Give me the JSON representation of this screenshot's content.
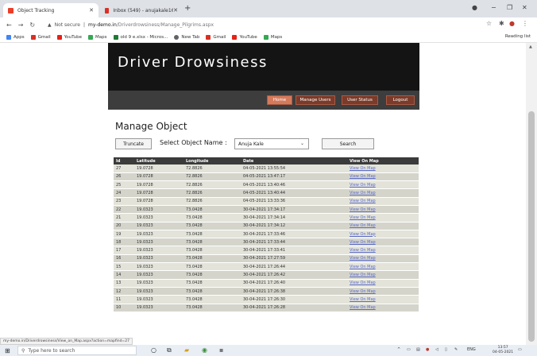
{
  "browser": {
    "tabs": [
      {
        "label": "Object Tracking",
        "active": true,
        "favicon_color": "#e83e2a"
      },
      {
        "label": "Inbox (549) - anujakale16@gmai",
        "active": false,
        "favicon_color": "#d93025"
      }
    ],
    "new_tab_icon": "plus-icon",
    "address": {
      "security": "Not secure",
      "host": "my-demo.in",
      "path": "/Driverdrowsiness/Manage_Pilgrims.aspx"
    },
    "bookmarks": [
      {
        "label": "Apps",
        "color": "#4285f4"
      },
      {
        "label": "Gmail",
        "color": "#d93025"
      },
      {
        "label": "YouTube",
        "color": "#e62117"
      },
      {
        "label": "Maps",
        "color": "#34a853"
      },
      {
        "label": "old 9 e.xlsx - Micros...",
        "color": "#1e7b34"
      },
      {
        "label": "New Tab",
        "color": "#5f6368"
      },
      {
        "label": "Gmail",
        "color": "#d93025"
      },
      {
        "label": "YouTube",
        "color": "#e62117"
      },
      {
        "label": "Maps",
        "color": "#34a853"
      }
    ],
    "reading_list": "Reading list",
    "status_url": "my-demo.in/Driverdrowsiness/View_on_Map.aspx?action=mapfind=27"
  },
  "header": {
    "title": "Driver Drowsiness",
    "menu": [
      {
        "label": "Home",
        "active": true
      },
      {
        "label": "Manage Users",
        "active": false
      },
      {
        "label": "User Status",
        "active": false
      },
      {
        "label": "Logout",
        "active": false
      }
    ]
  },
  "main": {
    "title": "Manage Object",
    "truncate_label": "Truncate",
    "select_label": "Select Object Name :",
    "selected_object": "Anuja Kale",
    "search_label": "Search"
  },
  "table": {
    "columns": [
      "Id",
      "Latitude",
      "Longitude",
      "Date",
      "View On Map"
    ],
    "link_text": "View On Map",
    "rows": [
      [
        "27",
        "19.0728",
        "72.8826",
        "04-05-2021 13:55:54"
      ],
      [
        "26",
        "19.0728",
        "72.8826",
        "04-05-2021 13:47:17"
      ],
      [
        "25",
        "19.0728",
        "72.8826",
        "04-05-2021 13:40:46"
      ],
      [
        "24",
        "19.0728",
        "72.8826",
        "04-05-2021 13:40:44"
      ],
      [
        "23",
        "19.0728",
        "72.8826",
        "04-05-2021 13:33:36"
      ],
      [
        "22",
        "19.0323",
        "73.0428",
        "30-04-2021 17:34:17"
      ],
      [
        "21",
        "19.0323",
        "73.0428",
        "30-04-2021 17:34:14"
      ],
      [
        "20",
        "19.0323",
        "73.0428",
        "30-04-2021 17:34:12"
      ],
      [
        "19",
        "19.0323",
        "73.0428",
        "30-04-2021 17:33:46"
      ],
      [
        "18",
        "19.0323",
        "73.0428",
        "30-04-2021 17:33:44"
      ],
      [
        "17",
        "19.0323",
        "73.0428",
        "30-04-2021 17:33:41"
      ],
      [
        "16",
        "19.0323",
        "73.0428",
        "30-04-2021 17:27:59"
      ],
      [
        "15",
        "19.0323",
        "73.0428",
        "30-04-2021 17:26:44"
      ],
      [
        "14",
        "19.0323",
        "73.0428",
        "30-04-2021 17:26:42"
      ],
      [
        "13",
        "19.0323",
        "73.0428",
        "30-04-2021 17:26:40"
      ],
      [
        "12",
        "19.0323",
        "73.0428",
        "30-04-2021 17:26:38"
      ],
      [
        "11",
        "19.0323",
        "73.0428",
        "30-04-2021 17:26:30"
      ],
      [
        "10",
        "19.0323",
        "73.0428",
        "30-04-2021 17:26:28"
      ]
    ]
  },
  "taskbar": {
    "search_placeholder": "Type here to search",
    "language": "ENG",
    "time": "13:57",
    "date": "04-05-2021"
  },
  "colors": {
    "banner_bg": "#141414",
    "menu_bar_bg": "#3d3d3d",
    "menu_button": "#7a3b2a",
    "menu_button_active": "#d67a5c",
    "table_header": "#3b3b3b",
    "link": "#5b6cc8"
  }
}
